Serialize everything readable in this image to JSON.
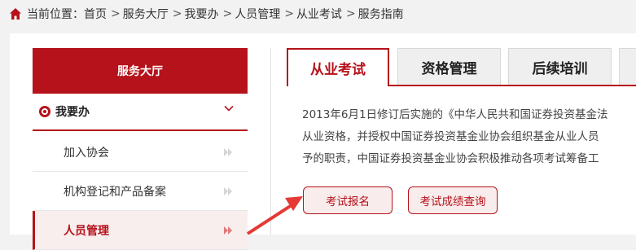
{
  "breadcrumb": {
    "prefix": "当前位置：",
    "items": [
      "首页",
      "服务大厅",
      "我要办",
      "人员管理",
      "从业考试",
      "服务指南"
    ]
  },
  "sidebar": {
    "title": "服务大厅",
    "group_label": "我要办",
    "items": [
      {
        "label": "加入协会"
      },
      {
        "label": "机构登记和产品备案"
      },
      {
        "label": "人员管理"
      }
    ]
  },
  "tabs": [
    {
      "label": "从业考试"
    },
    {
      "label": "资格管理"
    },
    {
      "label": "后续培训"
    }
  ],
  "content": {
    "lines": [
      "2013年6月1日修订后实施的《中华人民共和国证券投资基金法",
      "从业资格，并授权中国证券投资基金业协会组织基金从业人员",
      "予的职责，中国证券投资基金业协会积极推动各项考试筹备工"
    ]
  },
  "buttons": {
    "register": "考试报名",
    "score_query": "考试成绩查询"
  },
  "colors": {
    "brand": "#b5121b",
    "annotation": "#e53935"
  }
}
